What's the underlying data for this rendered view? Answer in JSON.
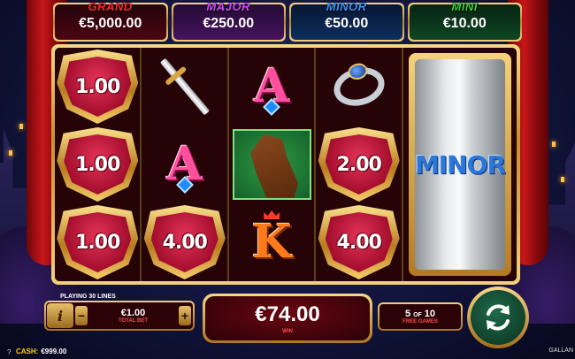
{
  "jackpots": [
    {
      "label": "GRAND",
      "value": "€5,000.00",
      "color": "#ff2a2a"
    },
    {
      "label": "MAJOR",
      "value": "€250.00",
      "color": "#c02bff"
    },
    {
      "label": "MINOR",
      "value": "€50.00",
      "color": "#2f8bff"
    },
    {
      "label": "MINI",
      "value": "€10.00",
      "color": "#3ad13a"
    }
  ],
  "reels": {
    "col1": [
      "1.00",
      "1.00",
      "1.00"
    ],
    "col2": {
      "top": "sword",
      "middle": "A",
      "bottom": "4.00"
    },
    "col3": {
      "top": "A",
      "middle": "horse",
      "bottom": "K"
    },
    "col4": {
      "top": "ring",
      "middle": "2.00",
      "bottom": "4.00"
    },
    "col5": {
      "expanded": "MINOR"
    }
  },
  "lines_text": "PLAYING 30 LINES",
  "controls": {
    "info_icon": "i",
    "minus": "−",
    "plus": "+",
    "total_bet_value": "€1.00",
    "total_bet_label": "TOTAL BET"
  },
  "win": {
    "value": "€74.00",
    "label": "WIN"
  },
  "free_games": {
    "current": "5",
    "of": "OF",
    "total": "10",
    "label": "FREE GAMES"
  },
  "footer": {
    "help": "?",
    "cash_label": "CASH:",
    "cash_value": "€999.00",
    "brand": "GALLAN"
  },
  "spin_icon": "refresh-arrows-icon"
}
